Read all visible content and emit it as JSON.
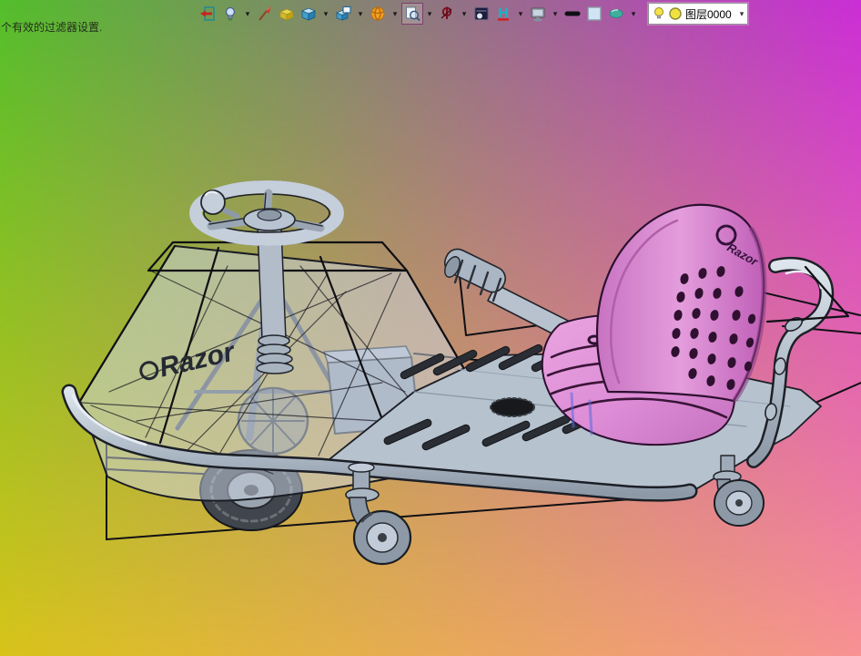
{
  "status_bar": {
    "message": "个有效的过滤器设置."
  },
  "toolbar": {
    "icons": [
      "exit-environment-icon",
      "light-toggle-icon",
      "brush-appearance-icon",
      "material-box-icon",
      "solid-cube-icon",
      "cube-window-icon",
      "orange-sphere-icon",
      "zoom-preview-icon",
      "section-pin-icon",
      "render-scene-icon",
      "dimension-h-icon",
      "display-monitor-icon",
      "line-thickness-icon",
      "color-swatch-icon",
      "lens-shade-icon"
    ],
    "dropdown_glyph": "▾"
  },
  "layer_control": {
    "label": "图层0000"
  },
  "viewport": {
    "background_corners": {
      "top_left": "#53be2c",
      "top_right": "#cb2ed6",
      "bottom_left": "#d8c31a",
      "bottom_right": "#f79292"
    },
    "model": {
      "name": "razor-crazy-cart",
      "front_logo": "Razor",
      "seat_logo": "Razor",
      "body_color": "#bcc6d2",
      "seat_color": "#dd8cd6",
      "wireframe_color": "#101014"
    }
  }
}
